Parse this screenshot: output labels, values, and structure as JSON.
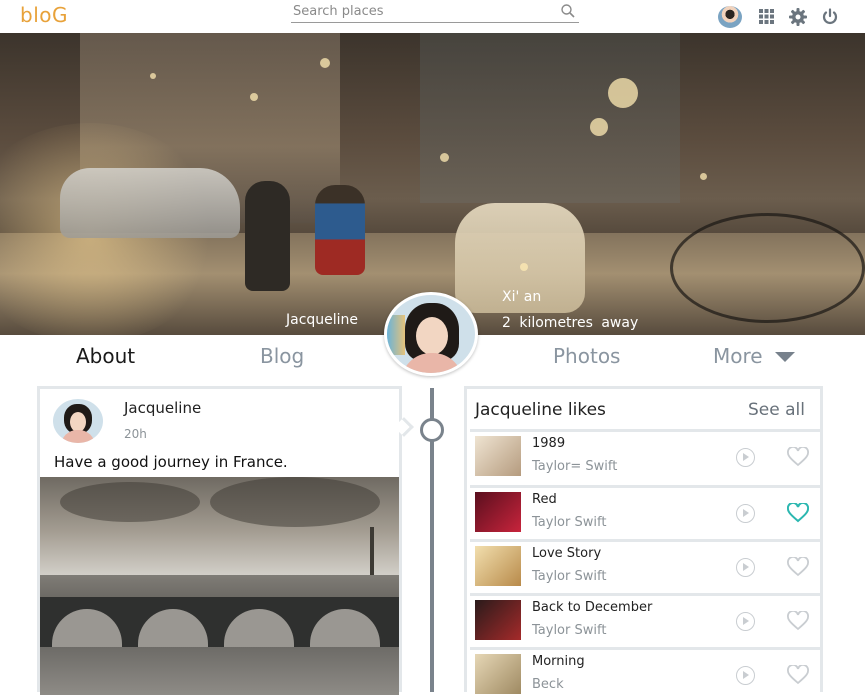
{
  "app": {
    "logo": "bloG"
  },
  "search": {
    "placeholder": "Search places"
  },
  "hero": {
    "name": "Jacqueline",
    "city": "Xi' an",
    "distance": "2 kilometres away"
  },
  "tabs": [
    {
      "label": "About",
      "active": true
    },
    {
      "label": "Blog",
      "active": false
    },
    {
      "label": "Photos",
      "active": false
    },
    {
      "label": "More",
      "active": false
    }
  ],
  "post": {
    "author": "Jacqueline",
    "time": "20h",
    "text": "Have a good  journey in France."
  },
  "likes": {
    "title": "Jacqueline likes",
    "see_all": "See all",
    "tracks": [
      {
        "title": "1989",
        "artist": "Taylor= Swift",
        "liked": false,
        "cover_color": "#d8c8b0"
      },
      {
        "title": "Red",
        "artist": "Taylor Swift",
        "liked": true,
        "cover_color": "#b2243a"
      },
      {
        "title": "Love Story",
        "artist": "Taylor Swift",
        "liked": false,
        "cover_color": "#d9b57a"
      },
      {
        "title": "Back to December",
        "artist": "Taylor Swift",
        "liked": false,
        "cover_color": "#8e2a2a"
      },
      {
        "title": "Morning",
        "artist": "Beck",
        "liked": false,
        "cover_color": "#c9b58e"
      }
    ]
  },
  "colors": {
    "logo": "#e8a23a",
    "liked_heart": "#2bb7b0",
    "timeline": "#7a838c"
  }
}
